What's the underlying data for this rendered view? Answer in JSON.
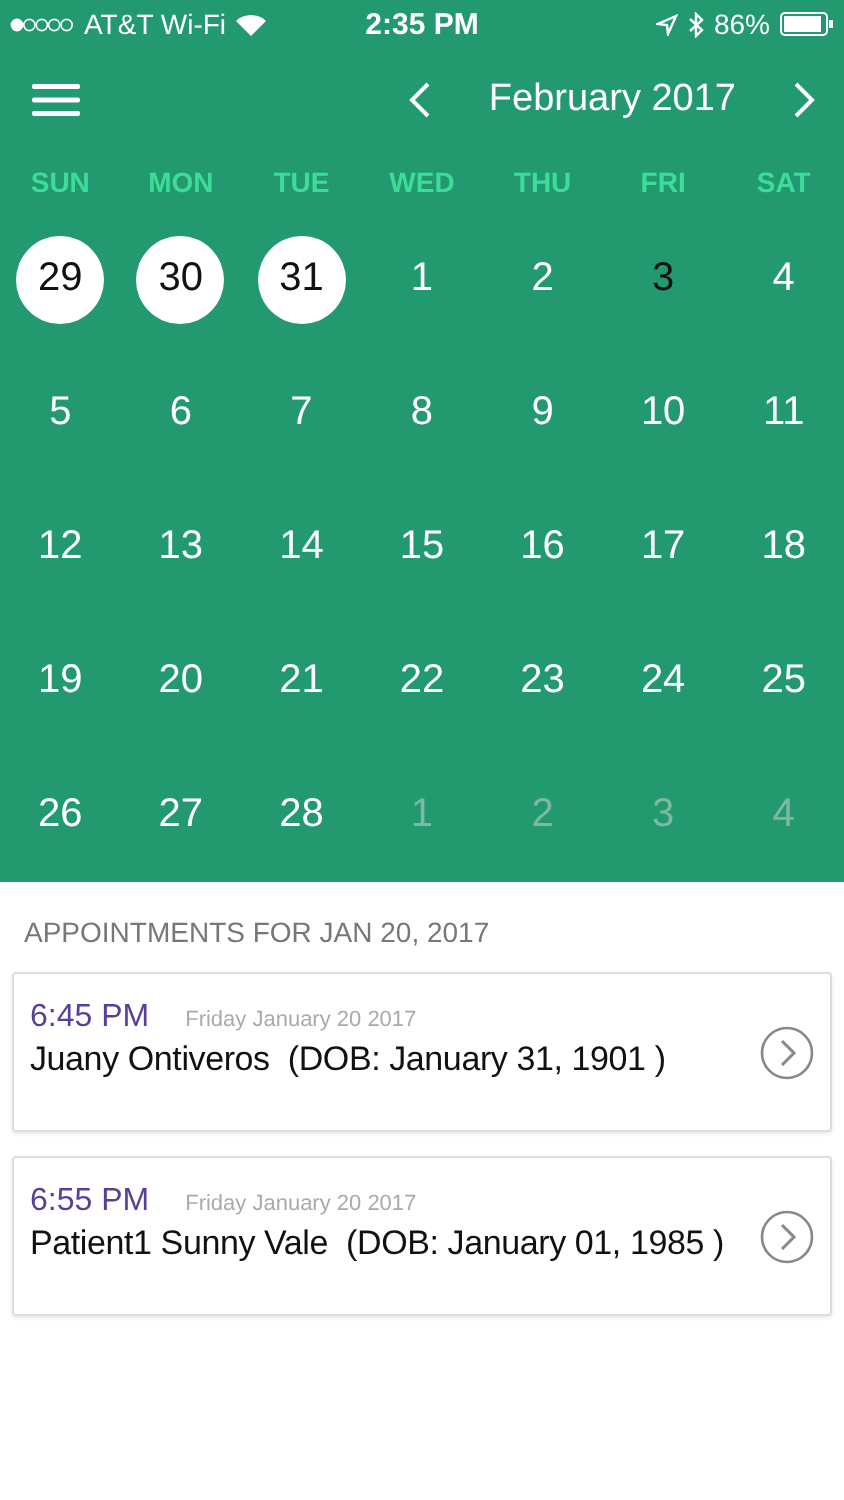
{
  "status_bar": {
    "carrier": "AT&T Wi-Fi",
    "time": "2:35 PM",
    "battery": "86%"
  },
  "header": {
    "month": "February 2017"
  },
  "weekdays": [
    "SUN",
    "MON",
    "TUE",
    "WED",
    "THU",
    "FRI",
    "SAT"
  ],
  "weeks": [
    [
      {
        "day": "29",
        "kind": "marked"
      },
      {
        "day": "30",
        "kind": "marked"
      },
      {
        "day": "31",
        "kind": "marked"
      },
      {
        "day": "1",
        "kind": "current"
      },
      {
        "day": "2",
        "kind": "current"
      },
      {
        "day": "3",
        "kind": "today"
      },
      {
        "day": "4",
        "kind": "current"
      }
    ],
    [
      {
        "day": "5",
        "kind": "current"
      },
      {
        "day": "6",
        "kind": "current"
      },
      {
        "day": "7",
        "kind": "current"
      },
      {
        "day": "8",
        "kind": "current"
      },
      {
        "day": "9",
        "kind": "current"
      },
      {
        "day": "10",
        "kind": "current"
      },
      {
        "day": "11",
        "kind": "current"
      }
    ],
    [
      {
        "day": "12",
        "kind": "current"
      },
      {
        "day": "13",
        "kind": "current"
      },
      {
        "day": "14",
        "kind": "current"
      },
      {
        "day": "15",
        "kind": "current"
      },
      {
        "day": "16",
        "kind": "current"
      },
      {
        "day": "17",
        "kind": "current"
      },
      {
        "day": "18",
        "kind": "current"
      }
    ],
    [
      {
        "day": "19",
        "kind": "current"
      },
      {
        "day": "20",
        "kind": "current"
      },
      {
        "day": "21",
        "kind": "current"
      },
      {
        "day": "22",
        "kind": "current"
      },
      {
        "day": "23",
        "kind": "current"
      },
      {
        "day": "24",
        "kind": "current"
      },
      {
        "day": "25",
        "kind": "current"
      }
    ],
    [
      {
        "day": "26",
        "kind": "current"
      },
      {
        "day": "27",
        "kind": "current"
      },
      {
        "day": "28",
        "kind": "current"
      },
      {
        "day": "1",
        "kind": "other"
      },
      {
        "day": "2",
        "kind": "other"
      },
      {
        "day": "3",
        "kind": "other"
      },
      {
        "day": "4",
        "kind": "other"
      }
    ]
  ],
  "appointments_heading": "APPOINTMENTS FOR JAN 20, 2017",
  "appointments": [
    {
      "time": "6:45 PM",
      "date": "Friday January 20 2017",
      "patient": "Juany Ontiveros  (DOB: January 31, 1901 )"
    },
    {
      "time": "6:55 PM",
      "date": "Friday January 20 2017",
      "patient": "Patient1 Sunny Vale  (DOB: January 01, 1985 )"
    }
  ]
}
